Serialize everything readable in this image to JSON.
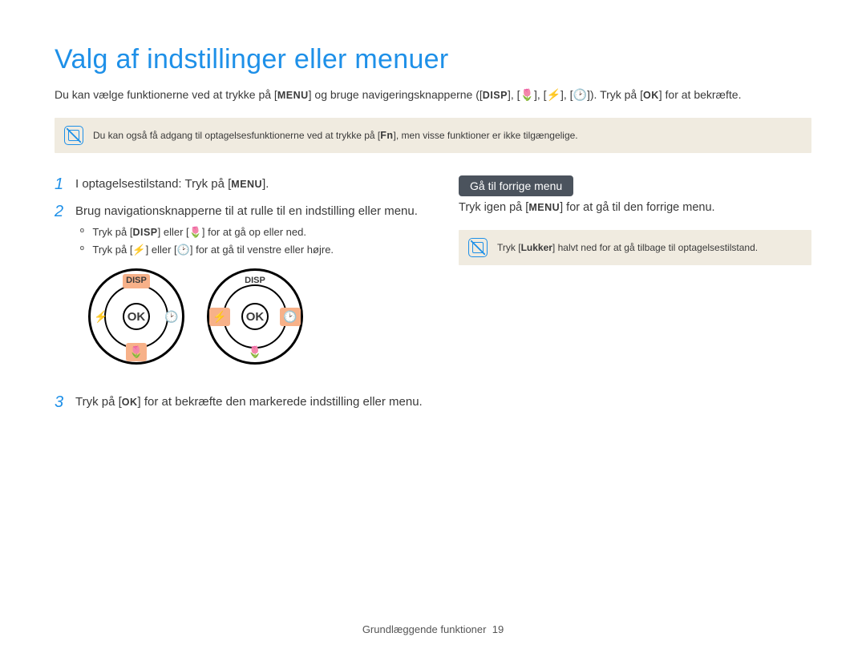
{
  "title": "Valg af indstillinger eller menuer",
  "intro": {
    "part1": "Du kan vælge funktionerne ved at trykke på [",
    "menu": "MENU",
    "part2": "] og bruge navigeringsknapperne ([",
    "disp": "DISP",
    "part3": "], [",
    "macro": "🌷",
    "part4": "], [",
    "flash": "⚡",
    "part5": "], [",
    "timer": "🕑",
    "part6": "]). Tryk på [",
    "ok": "OK",
    "part7": "] for at bekræfte."
  },
  "note1": {
    "pre": "Du kan også få adgang til optagelsesfunktionerne ved at trykke på [",
    "fn": "Fn",
    "post": "], men visse funktioner er ikke tilgængelige."
  },
  "steps": {
    "s1": {
      "num": "1",
      "pre": "I optagelsestilstand: Tryk på [",
      "menu": "MENU",
      "post": "]."
    },
    "s2": {
      "num": "2",
      "text": "Brug navigationsknapperne til at rulle til en indstilling eller menu.",
      "bullet1": {
        "pre": "Tryk på [",
        "disp": "DISP",
        "mid": "] eller [",
        "macro": "🌷",
        "post": "] for at gå op eller ned."
      },
      "bullet2": {
        "pre": "Tryk på [",
        "flash": "⚡",
        "mid": "] eller [",
        "timer": "🕑",
        "post": "] for at gå til venstre eller højre."
      }
    },
    "s3": {
      "num": "3",
      "pre": "Tryk på [",
      "ok": "OK",
      "post": "] for at bekræfte den markerede indstilling eller menu."
    }
  },
  "dial": {
    "disp": "DISP",
    "ok": "OK",
    "macro": "🌷",
    "flash": "⚡",
    "timer": "🕑"
  },
  "rightSection": {
    "badge": "Gå til forrige menu",
    "text": {
      "pre": "Tryk igen på [",
      "menu": "MENU",
      "post": "] for at gå til den forrige menu."
    }
  },
  "note2": {
    "pre": "Tryk [",
    "shutter": "Lukker",
    "post": "] halvt ned for at gå tilbage til optagelsestilstand."
  },
  "footer": {
    "label": "Grundlæggende funktioner",
    "page": "19"
  }
}
